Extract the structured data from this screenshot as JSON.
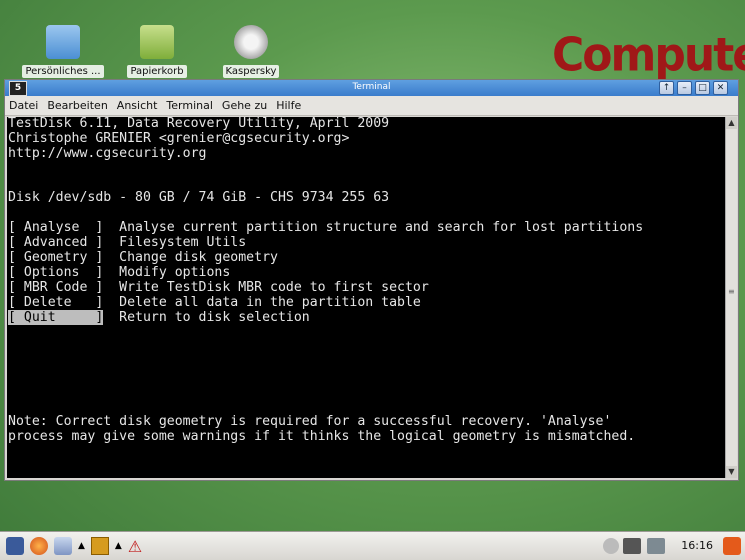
{
  "desktop": {
    "icons": [
      {
        "label": "Persönliches ..."
      },
      {
        "label": "Papierkorb"
      },
      {
        "label": "Kaspersky"
      }
    ],
    "logo_text": "Computer"
  },
  "window": {
    "title": "Terminal",
    "app_icon_text": "5",
    "menu": [
      "Datei",
      "Bearbeiten",
      "Ansicht",
      "Terminal",
      "Gehe zu",
      "Hilfe"
    ]
  },
  "terminal": {
    "lines": [
      "TestDisk 6.11, Data Recovery Utility, April 2009",
      "Christophe GRENIER <grenier@cgsecurity.org>",
      "http://www.cgsecurity.org",
      "",
      "",
      "Disk /dev/sdb - 80 GB / 74 GiB - CHS 9734 255 63",
      "",
      "[ Analyse  ]  Analyse current partition structure and search for lost partitions",
      "[ Advanced ]  Filesystem Utils",
      "[ Geometry ]  Change disk geometry",
      "[ Options  ]  Modify options",
      "[ MBR Code ]  Write TestDisk MBR code to first sector",
      "[ Delete   ]  Delete all data in the partition table",
      "",
      "",
      "",
      "",
      "",
      "",
      "Note: Correct disk geometry is required for a successful recovery. 'Analyse'",
      "process may give some warnings if it thinks the logical geometry is mismatched."
    ],
    "selected_option": "[ Quit     ]",
    "selected_desc": "  Return to disk selection"
  },
  "taskbar": {
    "clock": "16:16"
  }
}
